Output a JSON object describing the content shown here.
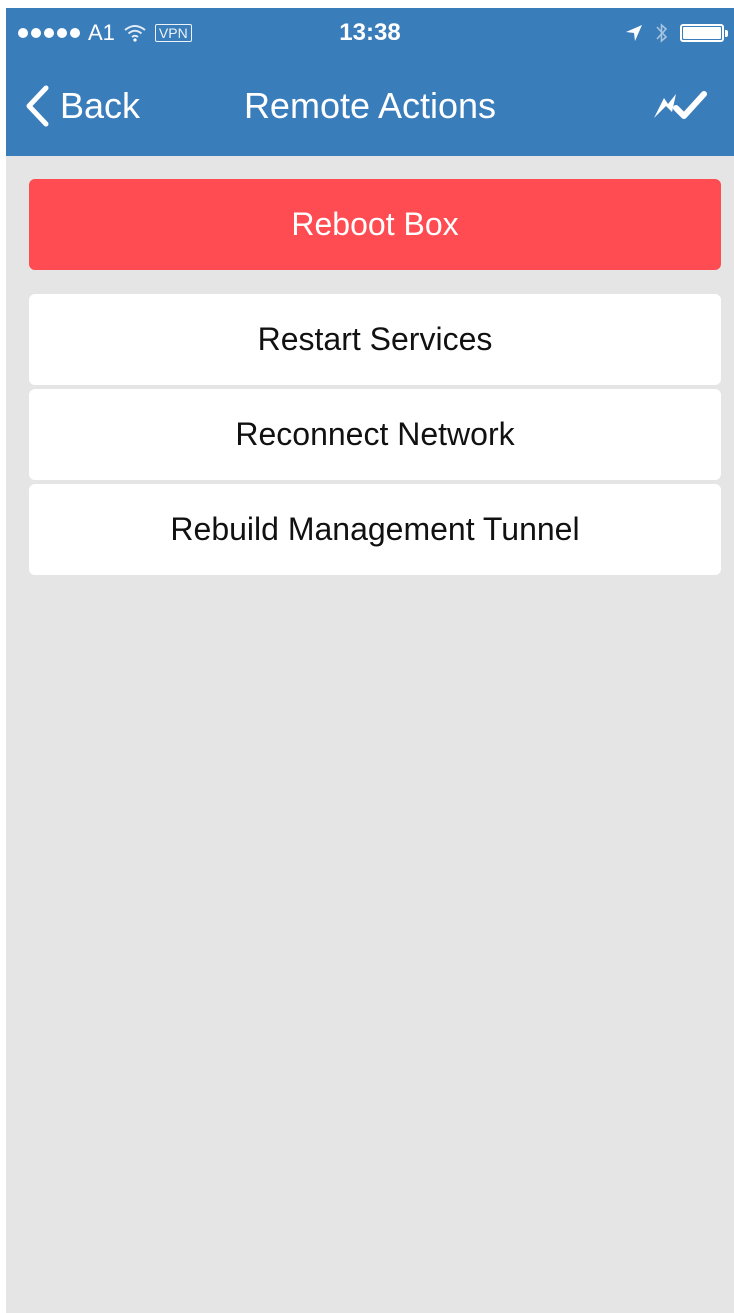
{
  "status_bar": {
    "carrier": "A1",
    "vpn": "VPN",
    "time": "13:38",
    "icons": [
      "signal-dots-icon",
      "wifi-icon",
      "location-arrow-icon",
      "bluetooth-icon",
      "battery-icon"
    ],
    "battery_level": 1.0
  },
  "nav": {
    "back_label": "Back",
    "title": "Remote Actions",
    "action_icon": "check-arrows-icon"
  },
  "actions": {
    "primary_label": "Reboot Box",
    "items": [
      {
        "label": "Restart Services"
      },
      {
        "label": "Reconnect Network"
      },
      {
        "label": "Rebuild Management Tunnel"
      }
    ]
  },
  "colors": {
    "header_bg": "#3a7dbb",
    "primary_button": "#ff4c52",
    "content_bg": "#e5e5e5",
    "item_bg": "#ffffff"
  }
}
